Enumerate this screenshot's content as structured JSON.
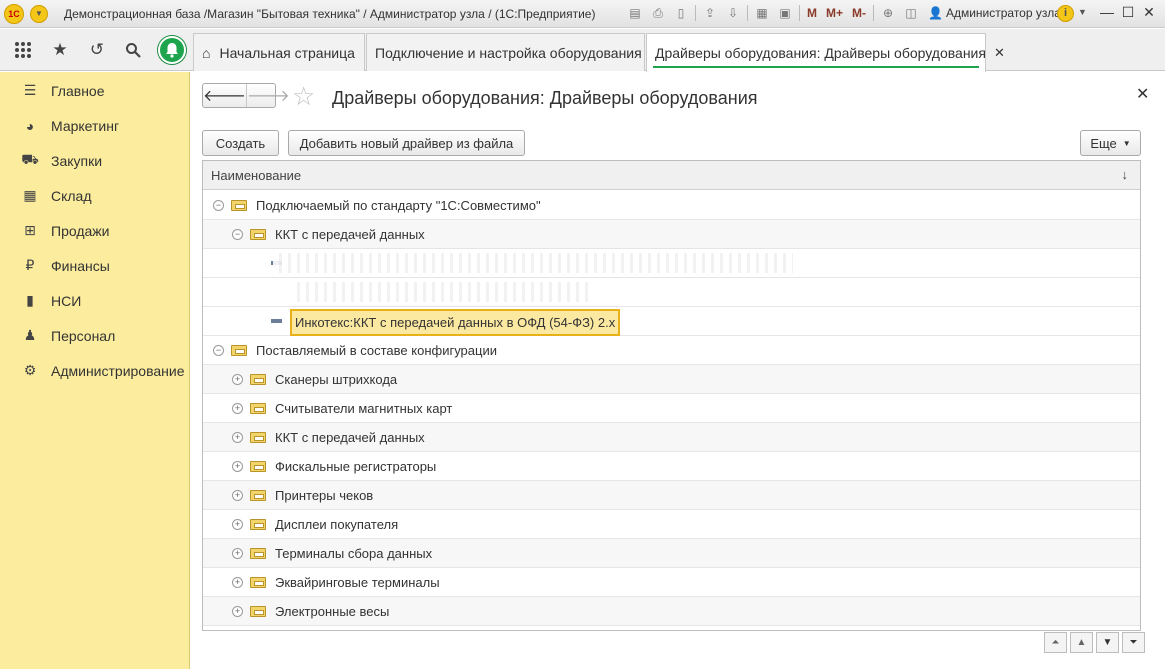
{
  "window": {
    "title": "Демонстрационная база /Магазин \"Бытовая техника\" / Администратор узла /  (1С:Предприятие)",
    "logo": "1С",
    "user": "Администратор узла",
    "m": "M",
    "mplus": "M+",
    "mminus": "M-"
  },
  "tabs": [
    {
      "label": "Начальная страница"
    },
    {
      "label": "Подключение и настройка оборудования"
    },
    {
      "label": "Драйверы оборудования: Драйверы оборудования"
    }
  ],
  "sidebar": {
    "items": [
      {
        "label": "Главное",
        "icon": "menu-icon"
      },
      {
        "label": "Маркетинг",
        "icon": "pie-chart-icon"
      },
      {
        "label": "Закупки",
        "icon": "cart-icon"
      },
      {
        "label": "Склад",
        "icon": "warehouse-icon"
      },
      {
        "label": "Продажи",
        "icon": "basket-icon"
      },
      {
        "label": "Финансы",
        "icon": "ruble-icon"
      },
      {
        "label": "НСИ",
        "icon": "book-icon"
      },
      {
        "label": "Персонал",
        "icon": "person-icon"
      },
      {
        "label": "Администрирование",
        "icon": "gear-icon"
      }
    ]
  },
  "page": {
    "title": "Драйверы оборудования: Драйверы оборудования",
    "create_label": "Создать",
    "add_from_file_label": "Добавить новый драйвер из файла",
    "more_label": "Еще"
  },
  "grid": {
    "column": "Наименование",
    "sort_glyph": "↓",
    "rows": [
      {
        "label": "Подключаемый по стандарту \"1С:Совместимо\"",
        "level": 0,
        "kind": "group-open"
      },
      {
        "label": "ККТ с передачей данных",
        "level": 1,
        "kind": "group-open"
      },
      {
        "label": "",
        "level": 2,
        "kind": "obscured"
      },
      {
        "label": "",
        "level": 2,
        "kind": "obscured"
      },
      {
        "label": "Инкотекс:ККТ с передачей данных в ОФД (54-ФЗ) 2.x",
        "level": 2,
        "kind": "selected"
      },
      {
        "label": "Поставляемый в составе конфигурации",
        "level": 0,
        "kind": "group-open"
      },
      {
        "label": "Сканеры штрихкода",
        "level": 1,
        "kind": "group-closed"
      },
      {
        "label": "Считыватели магнитных карт",
        "level": 1,
        "kind": "group-closed"
      },
      {
        "label": "ККТ с передачей данных",
        "level": 1,
        "kind": "group-closed"
      },
      {
        "label": "Фискальные регистраторы",
        "level": 1,
        "kind": "group-closed"
      },
      {
        "label": "Принтеры чеков",
        "level": 1,
        "kind": "group-closed"
      },
      {
        "label": "Дисплеи покупателя",
        "level": 1,
        "kind": "group-closed"
      },
      {
        "label": "Терминалы сбора данных",
        "level": 1,
        "kind": "group-closed"
      },
      {
        "label": "Эквайринговые терминалы",
        "level": 1,
        "kind": "group-closed"
      },
      {
        "label": "Электронные весы",
        "level": 1,
        "kind": "group-closed"
      }
    ]
  },
  "colors": {
    "sidebar_bg": "#fbec9e",
    "accent_green": "#1ea44c",
    "selection_border": "#e8b11a",
    "selection_bg": "#fbe9a2"
  }
}
